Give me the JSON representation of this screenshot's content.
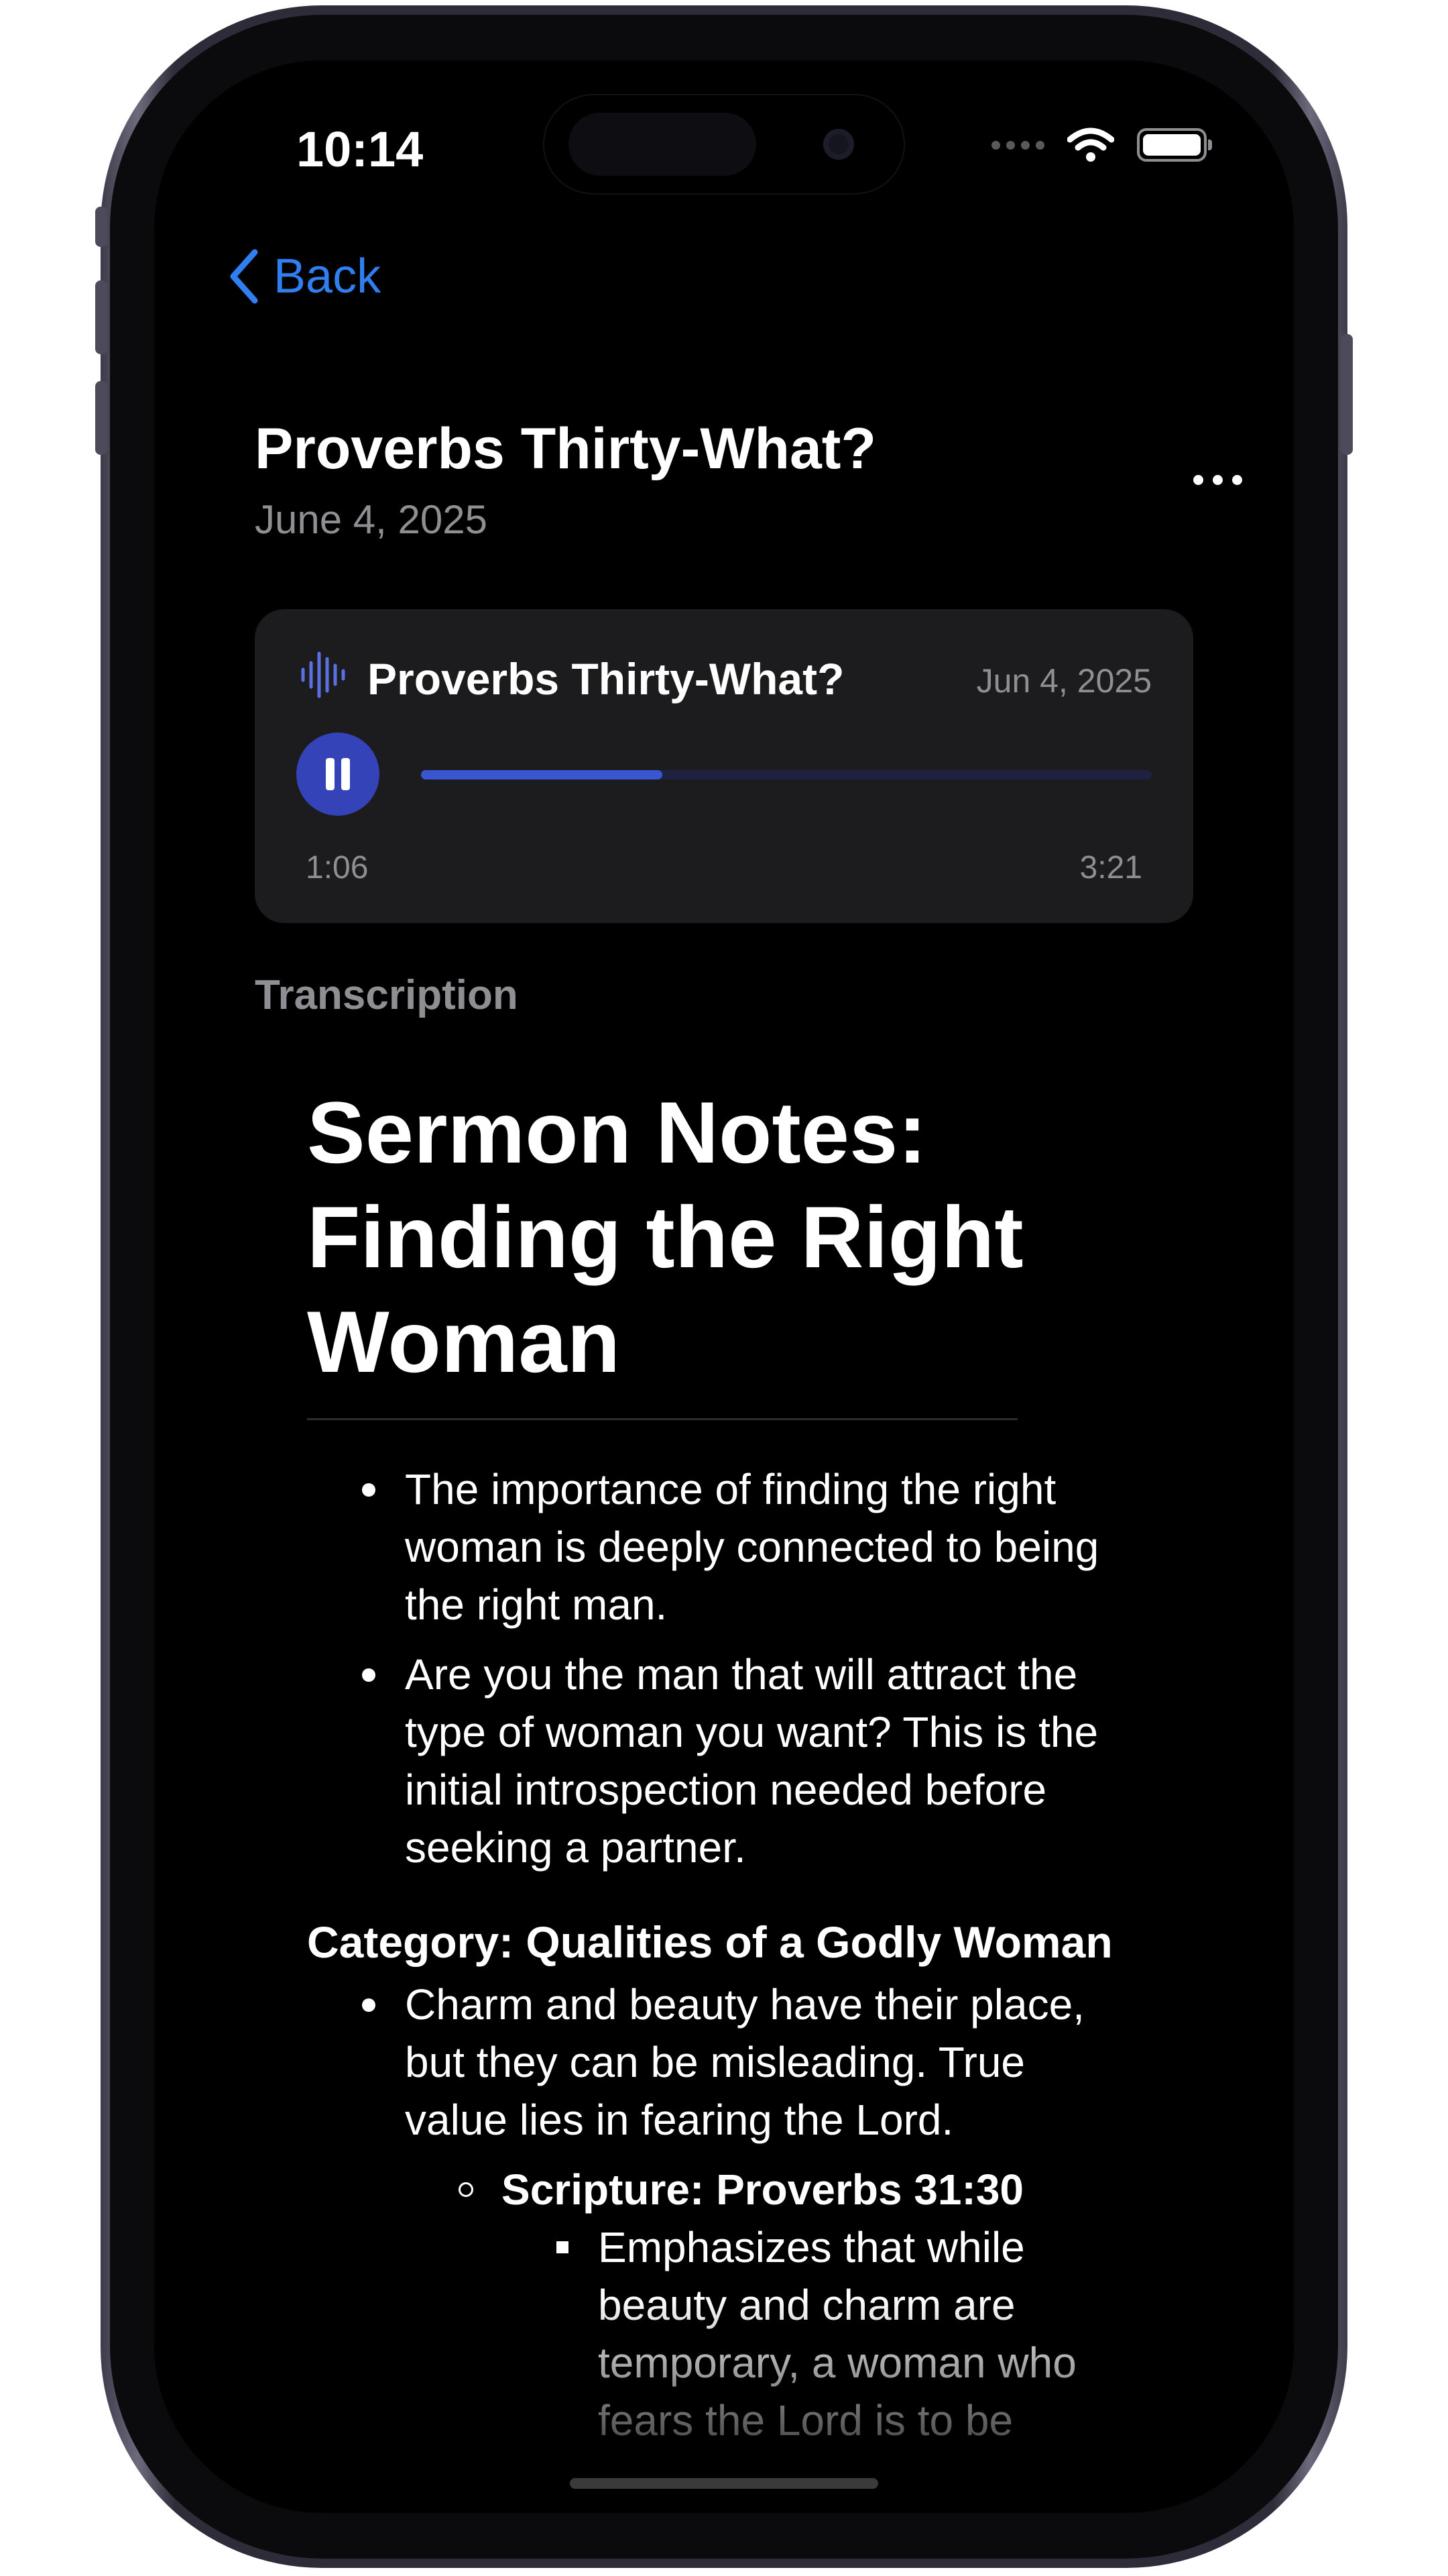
{
  "status_bar": {
    "time": "10:14"
  },
  "nav": {
    "back_label": "Back"
  },
  "header": {
    "title": "Proverbs Thirty-What?",
    "date": "June 4, 2025"
  },
  "player": {
    "title": "Proverbs Thirty-What?",
    "date": "Jun 4, 2025",
    "elapsed": "1:06",
    "total": "3:21",
    "progress_fraction": 0.33,
    "accent_color": "#3443b8"
  },
  "transcription": {
    "section_label": "Transcription",
    "heading": "Sermon Notes: Finding the Right Woman",
    "bullets": [
      "The importance of finding the right woman is deeply connected to being the right man.",
      "Are you the man that will attract the type of woman you want? This is the initial introspection needed before seeking a partner."
    ],
    "category": "Category: Qualities of a Godly Woman",
    "category_bullet": "Charm and beauty have their place, but they can be misleading. True value lies in fearing the Lord.",
    "scripture": "Scripture: Proverbs 31:30",
    "scripture_note": "Emphasizes that while beauty and charm are temporary, a woman who fears the Lord is to be"
  },
  "icons": {
    "back": "chevron-left-icon",
    "more": "ellipsis-icon",
    "audio": "waveform-icon",
    "play_pause": "pause-icon",
    "wifi": "wifi-icon",
    "battery": "battery-icon"
  },
  "colors": {
    "link": "#2f7ff0",
    "background": "#000000",
    "card": "#1c1c1e",
    "secondary_text": "#8e8e93"
  }
}
